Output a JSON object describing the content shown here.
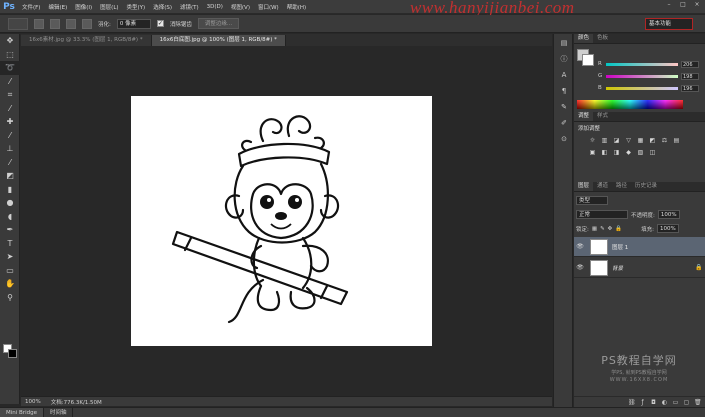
{
  "app": {
    "logo": "Ps"
  },
  "menu": [
    "文件(F)",
    "编辑(E)",
    "图像(I)",
    "图层(L)",
    "类型(Y)",
    "选择(S)",
    "滤镜(T)",
    "3D(D)",
    "视图(V)",
    "窗口(W)",
    "帮助(H)"
  ],
  "watermark": "www.hanyijianbei.com",
  "options": {
    "feather_label": "羽化:",
    "feather_value": "0 像素",
    "antialias_label": "消除锯齿",
    "refine_edge_label": "调整边缘...",
    "workspace": "基本功能"
  },
  "doc_tabs": [
    {
      "label": "16x6素材.jpg @ 33.3% (图层 1, RGB/8#) *",
      "active": false
    },
    {
      "label": "16x6白底图.jpg @ 100% (图层 1, RGB/8#) *",
      "active": true
    }
  ],
  "status": {
    "zoom": "100%",
    "doc_info": "文档:776.3K/1.50M"
  },
  "bottom_tabs": [
    "Mini Bridge",
    "时间轴"
  ],
  "panels": {
    "color_tabs": [
      "颜色",
      "色板"
    ],
    "color": {
      "r_label": "R",
      "r_value": "206",
      "g_label": "G",
      "g_value": "198",
      "b_label": "B",
      "b_value": "196",
      "fg": "#cec6c4"
    },
    "adj_tabs": [
      "调整",
      "样式"
    ],
    "adj_title": "添加调整",
    "adj_icons": [
      "☼",
      "▥",
      "◪",
      "▽",
      "▦",
      "◩",
      "⚖",
      "▤",
      "▣",
      "◧",
      "◨",
      "◆",
      "▧",
      "◫"
    ],
    "layers_tabs": [
      "图层",
      "通道",
      "路径",
      "历史记录"
    ],
    "layers": {
      "kind_label": "类型",
      "blend": "正常",
      "opacity_label": "不透明度:",
      "opacity": "100%",
      "lock_label": "锁定:",
      "fill_label": "填充:",
      "fill": "100%",
      "items": [
        {
          "name": "图层 1",
          "selected": true,
          "italic": false,
          "locked": false
        },
        {
          "name": "背景",
          "selected": false,
          "italic": true,
          "locked": true
        }
      ]
    }
  },
  "brand": {
    "line1": "PS教程自学网",
    "line2": "学PS, 就到PS教程自学网",
    "line3": "WWW.16XX8.COM"
  }
}
